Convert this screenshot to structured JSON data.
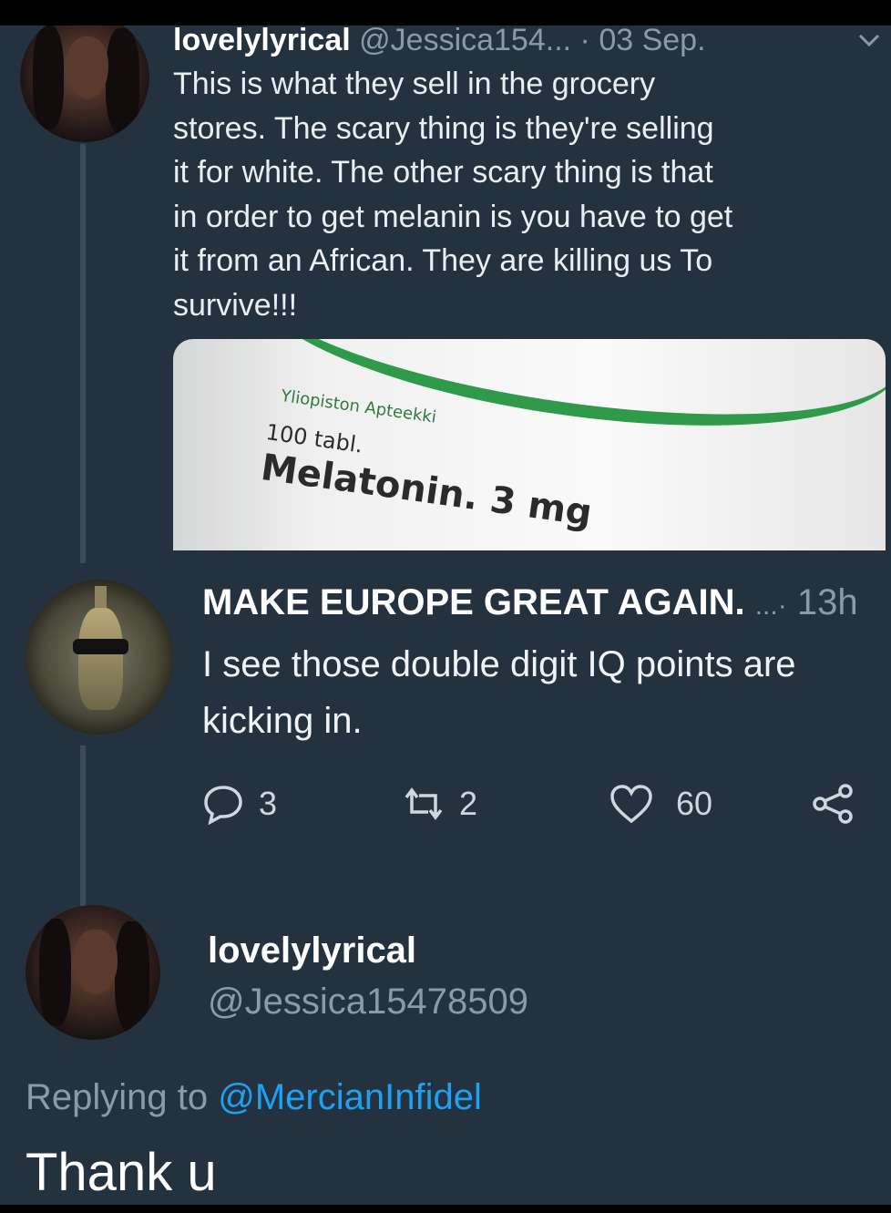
{
  "tweet1": {
    "display_name": "lovelylyrical",
    "handle": "@Jessica154...",
    "date": "· 03 Sep.",
    "text_lines": [
      "This is what they sell in the grocery",
      "stores. The scary thing is they're selling",
      "it for white. The other scary thing is that",
      "in order to get melanin is you have to get",
      "it from an African. They are killing us To",
      "survive!!!"
    ],
    "media": {
      "brand": "Yliopiston Apteekki",
      "count": "100 tabl.",
      "product": "Melatonin. 3 mg"
    }
  },
  "tweet2": {
    "display_name": "MAKE EUROPE GREAT AGAIN.",
    "more": "...·",
    "time": "13h",
    "text_lines": [
      "I see those double digit IQ points are",
      "kicking in."
    ],
    "replies": "3",
    "retweets": "2",
    "likes": "60"
  },
  "reply": {
    "display_name": "lovelylyrical",
    "handle": "@Jessica15478509",
    "replying_to_label": "Replying to",
    "replying_to_handle": "@MercianInfidel",
    "text": "Thank u"
  },
  "colors": {
    "background": "#243240",
    "link": "#1da1f2",
    "muted": "#8c99a6"
  }
}
